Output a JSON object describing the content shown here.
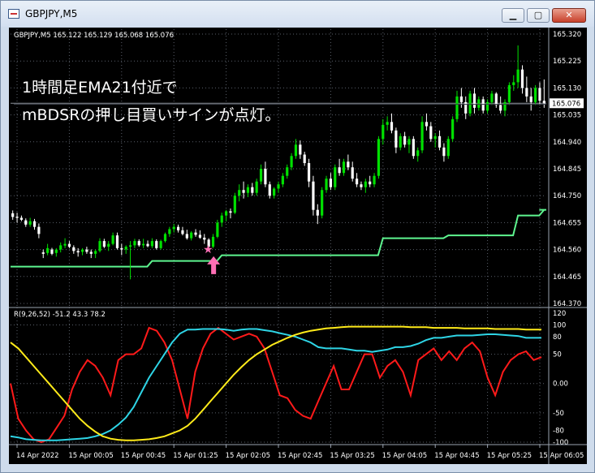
{
  "window": {
    "title": "GBPJPY,M5"
  },
  "colors": {
    "bg": "#000000",
    "grid": "#5a5f6a",
    "bull": "#00e000",
    "bear": "#ffffff",
    "ema": "#5ef58f",
    "signal": "#ff6fb5",
    "red": "#ff1a1a",
    "cyan": "#2ed5e6",
    "yellow": "#ffeb1a",
    "axis_text": "#ffffff",
    "price_tag_bg": "#ffffff",
    "price_tag_fg": "#000000"
  },
  "chart_data": [
    {
      "type": "candlestick",
      "header": "GBPJPY,M5  165.122 165.129 165.068 165.076",
      "annotation_lines": [
        "1時間足EMA21付近で",
        "mBDSRの押し目買いサインが点灯。"
      ],
      "yticks": [
        "165.320",
        "165.225",
        "165.130",
        "165.035",
        "164.940",
        "164.845",
        "164.750",
        "164.655",
        "164.560",
        "164.465",
        "164.370"
      ],
      "ylim": [
        164.37,
        165.32
      ],
      "current_price": "165.076",
      "signal_index": 45,
      "ohlc": [
        [
          164.688,
          164.698,
          164.665,
          164.675
        ],
        [
          164.676,
          164.69,
          164.655,
          164.672
        ],
        [
          164.672,
          164.68,
          164.66,
          164.665
        ],
        [
          164.663,
          164.67,
          164.64,
          164.648
        ],
        [
          164.648,
          164.672,
          164.64,
          164.66
        ],
        [
          164.66,
          164.668,
          164.63,
          164.64
        ],
        [
          164.64,
          164.652,
          164.6,
          164.615
        ],
        [
          164.55,
          164.56,
          164.53,
          164.545
        ],
        [
          164.548,
          164.58,
          164.54,
          164.565
        ],
        [
          164.56,
          164.566,
          164.54,
          164.545
        ],
        [
          164.548,
          164.565,
          164.535,
          164.56
        ],
        [
          164.56,
          164.585,
          164.55,
          164.575
        ],
        [
          164.574,
          164.6,
          164.565,
          164.58
        ],
        [
          164.58,
          164.59,
          164.565,
          164.57
        ],
        [
          164.568,
          164.575,
          164.545,
          164.555
        ],
        [
          164.555,
          164.565,
          164.535,
          164.55
        ],
        [
          164.552,
          164.565,
          164.54,
          164.56
        ],
        [
          164.56,
          164.57,
          164.545,
          164.552
        ],
        [
          164.552,
          164.56,
          164.53,
          164.545
        ],
        [
          164.545,
          164.56,
          164.53,
          164.555
        ],
        [
          164.555,
          164.6,
          164.55,
          164.59
        ],
        [
          164.59,
          164.598,
          164.565,
          164.57
        ],
        [
          164.57,
          164.59,
          164.555,
          164.58
        ],
        [
          164.58,
          164.62,
          164.575,
          164.61
        ],
        [
          164.61,
          164.62,
          164.56,
          164.565
        ],
        [
          164.565,
          164.58,
          164.54,
          164.56
        ],
        [
          164.56,
          164.575,
          164.545,
          164.57
        ],
        [
          164.57,
          164.59,
          164.455,
          164.575
        ],
        [
          164.575,
          164.598,
          164.565,
          164.59
        ],
        [
          164.59,
          164.596,
          164.57,
          164.575
        ],
        [
          164.575,
          164.598,
          164.565,
          164.58
        ],
        [
          164.58,
          164.592,
          164.568,
          164.572
        ],
        [
          164.572,
          164.6,
          164.565,
          164.59
        ],
        [
          164.59,
          164.596,
          164.56,
          164.565
        ],
        [
          164.565,
          164.595,
          164.56,
          164.59
        ],
        [
          164.59,
          164.62,
          164.585,
          164.615
        ],
        [
          164.615,
          164.64,
          164.605,
          164.632
        ],
        [
          164.632,
          164.65,
          164.62,
          164.64
        ],
        [
          164.64,
          164.648,
          164.62,
          164.628
        ],
        [
          164.628,
          164.64,
          164.61,
          164.615
        ],
        [
          164.615,
          164.63,
          164.595,
          164.6
        ],
        [
          164.6,
          164.625,
          164.592,
          164.62
        ],
        [
          164.62,
          164.632,
          164.605,
          164.612
        ],
        [
          164.612,
          164.628,
          164.598,
          164.602
        ],
        [
          164.602,
          164.615,
          164.58,
          164.595
        ],
        [
          164.595,
          164.6,
          164.565,
          164.57
        ],
        [
          164.57,
          164.615,
          164.565,
          164.605
        ],
        [
          164.605,
          164.665,
          164.6,
          164.655
        ],
        [
          164.655,
          164.69,
          164.64,
          164.68
        ],
        [
          164.68,
          164.7,
          164.66,
          164.695
        ],
        [
          164.695,
          164.705,
          164.67,
          164.69
        ],
        [
          164.69,
          164.76,
          164.685,
          164.75
        ],
        [
          164.75,
          164.79,
          164.73,
          164.77
        ],
        [
          164.77,
          164.8,
          164.74,
          164.76
        ],
        [
          164.76,
          164.79,
          164.745,
          164.78
        ],
        [
          164.78,
          164.795,
          164.75,
          164.76
        ],
        [
          164.76,
          164.81,
          164.75,
          164.8
        ],
        [
          164.8,
          164.86,
          164.79,
          164.845
        ],
        [
          164.845,
          164.87,
          164.78,
          164.79
        ],
        [
          164.79,
          164.8,
          164.74,
          164.75
        ],
        [
          164.75,
          164.78,
          164.74,
          164.775
        ],
        [
          164.775,
          164.8,
          164.76,
          164.79
        ],
        [
          164.79,
          164.83,
          164.78,
          164.82
        ],
        [
          164.82,
          164.86,
          164.81,
          164.85
        ],
        [
          164.85,
          164.9,
          164.84,
          164.89
        ],
        [
          164.89,
          164.95,
          164.88,
          164.93
        ],
        [
          164.93,
          164.945,
          164.88,
          164.895
        ],
        [
          164.895,
          164.905,
          164.855,
          164.865
        ],
        [
          164.865,
          164.88,
          164.78,
          164.8
        ],
        [
          164.8,
          164.82,
          164.68,
          164.7
        ],
        [
          164.7,
          164.72,
          164.65,
          164.68
        ],
        [
          164.68,
          164.78,
          164.67,
          164.77
        ],
        [
          164.77,
          164.82,
          164.76,
          164.81
        ],
        [
          164.81,
          164.83,
          164.77,
          164.78
        ],
        [
          164.78,
          164.86,
          164.77,
          164.85
        ],
        [
          164.85,
          164.88,
          164.82,
          164.83
        ],
        [
          164.83,
          164.88,
          164.82,
          164.87
        ],
        [
          164.87,
          164.895,
          164.84,
          164.85
        ],
        [
          164.85,
          164.87,
          164.8,
          164.81
        ],
        [
          164.81,
          164.83,
          164.78,
          164.79
        ],
        [
          164.79,
          164.8,
          164.77,
          164.78
        ],
        [
          164.78,
          164.81,
          164.76,
          164.8
        ],
        [
          164.8,
          164.82,
          164.78,
          164.79
        ],
        [
          164.79,
          164.83,
          164.78,
          164.82
        ],
        [
          164.82,
          164.96,
          164.81,
          164.95
        ],
        [
          164.95,
          165.02,
          164.93,
          165.0
        ],
        [
          165.0,
          165.03,
          164.98,
          165.01
        ],
        [
          165.01,
          165.04,
          164.97,
          164.98
        ],
        [
          164.98,
          164.99,
          164.9,
          164.92
        ],
        [
          164.92,
          164.97,
          164.91,
          164.96
        ],
        [
          164.96,
          164.975,
          164.92,
          164.93
        ],
        [
          164.93,
          164.96,
          164.9,
          164.95
        ],
        [
          164.95,
          164.96,
          164.88,
          164.89
        ],
        [
          164.89,
          164.92,
          164.87,
          164.91
        ],
        [
          164.91,
          165.03,
          164.9,
          165.01
        ],
        [
          165.01,
          165.04,
          164.98,
          164.995
        ],
        [
          164.995,
          165.01,
          164.94,
          164.95
        ],
        [
          164.95,
          164.97,
          164.92,
          164.96
        ],
        [
          164.96,
          164.98,
          164.91,
          164.92
        ],
        [
          164.92,
          164.935,
          164.87,
          164.89
        ],
        [
          164.89,
          164.96,
          164.88,
          164.95
        ],
        [
          164.95,
          165.03,
          164.94,
          165.02
        ],
        [
          165.02,
          165.12,
          165.01,
          165.1
        ],
        [
          165.1,
          165.13,
          165.06,
          165.08
        ],
        [
          165.08,
          165.1,
          165.02,
          165.04
        ],
        [
          165.04,
          165.12,
          165.03,
          165.11
        ],
        [
          165.11,
          165.13,
          165.04,
          165.06
        ],
        [
          165.06,
          165.1,
          165.05,
          165.09
        ],
        [
          165.09,
          165.1,
          165.04,
          165.05
        ],
        [
          165.05,
          165.09,
          165.04,
          165.08
        ],
        [
          165.08,
          165.12,
          165.07,
          165.11
        ],
        [
          165.11,
          165.115,
          165.06,
          165.07
        ],
        [
          165.07,
          165.1,
          165.04,
          165.05
        ],
        [
          165.05,
          165.09,
          165.03,
          165.08
        ],
        [
          165.08,
          165.15,
          165.07,
          165.14
        ],
        [
          165.14,
          165.175,
          165.12,
          165.15
        ],
        [
          165.15,
          165.28,
          165.13,
          165.195
        ],
        [
          165.195,
          165.21,
          165.11,
          165.13
        ],
        [
          165.13,
          165.17,
          165.08,
          165.1
        ],
        [
          165.1,
          165.13,
          165.05,
          165.08
        ],
        [
          165.08,
          165.14,
          165.07,
          165.13
        ],
        [
          165.13,
          165.15,
          165.07,
          165.085
        ],
        [
          165.085,
          165.16,
          165.06,
          165.076
        ]
      ],
      "ema_steps": [
        [
          0,
          164.5
        ],
        [
          32,
          164.52
        ],
        [
          48,
          164.54
        ],
        [
          75,
          164.54
        ],
        [
          85,
          164.6
        ],
        [
          100,
          164.61
        ],
        [
          116,
          164.68
        ],
        [
          127,
          164.7
        ],
        [
          140,
          164.7
        ]
      ]
    },
    {
      "type": "line",
      "header": "R(9,26,52) -51.2 43.3 78.2",
      "yticks": [
        "120",
        "100",
        "80",
        "50",
        "0.00",
        "-50",
        "-80",
        "-100"
      ],
      "ylim": [
        -100,
        120
      ],
      "series": [
        {
          "color": "red",
          "values": [
            0,
            -60,
            -80,
            -95,
            -100,
            -95,
            -75,
            -55,
            -10,
            20,
            40,
            30,
            10,
            -20,
            40,
            50,
            50,
            60,
            95,
            90,
            70,
            40,
            -10,
            -60,
            20,
            60,
            85,
            95,
            85,
            75,
            80,
            85,
            80,
            60,
            20,
            -20,
            -25,
            -45,
            -55,
            -60,
            -30,
            0,
            30,
            -10,
            -10,
            20,
            50,
            50,
            10,
            30,
            40,
            20,
            -20,
            40,
            50,
            60,
            40,
            55,
            40,
            60,
            70,
            55,
            10,
            -20,
            20,
            40,
            50,
            55,
            40,
            45
          ]
        },
        {
          "color": "cyan",
          "values": [
            -90,
            -92,
            -95,
            -96,
            -97,
            -97,
            -97,
            -96,
            -95,
            -94,
            -93,
            -90,
            -86,
            -80,
            -70,
            -58,
            -40,
            -15,
            10,
            30,
            50,
            70,
            85,
            92,
            92,
            93,
            93,
            93,
            92,
            90,
            92,
            93,
            93,
            91,
            89,
            86,
            83,
            80,
            75,
            70,
            62,
            60,
            60,
            60,
            58,
            56,
            56,
            54,
            56,
            58,
            62,
            62,
            64,
            68,
            74,
            78,
            78,
            80,
            82,
            82,
            82,
            83,
            84,
            84,
            83,
            82,
            81,
            78,
            78,
            78
          ]
        },
        {
          "color": "yellow",
          "values": [
            70,
            60,
            45,
            30,
            15,
            0,
            -15,
            -30,
            -45,
            -60,
            -72,
            -82,
            -90,
            -94,
            -96,
            -97,
            -97,
            -96,
            -95,
            -93,
            -90,
            -85,
            -80,
            -72,
            -60,
            -45,
            -30,
            -15,
            0,
            15,
            28,
            40,
            50,
            58,
            66,
            72,
            78,
            83,
            87,
            90,
            92,
            94,
            95,
            96,
            97,
            97,
            97,
            97,
            97,
            97,
            97,
            97,
            96,
            96,
            96,
            95,
            95,
            95,
            95,
            94,
            94,
            94,
            94,
            93,
            93,
            93,
            93,
            92,
            92,
            92
          ]
        }
      ]
    },
    {
      "type": "time_axis",
      "labels": [
        "14 Apr 2022",
        "15 Apr 00:05",
        "15 Apr 00:45",
        "15 Apr 01:25",
        "15 Apr 02:05",
        "15 Apr 02:45",
        "15 Apr 03:25",
        "15 Apr 04:05",
        "15 Apr 04:45",
        "15 Apr 05:25",
        "15 Apr 06:05"
      ]
    }
  ]
}
